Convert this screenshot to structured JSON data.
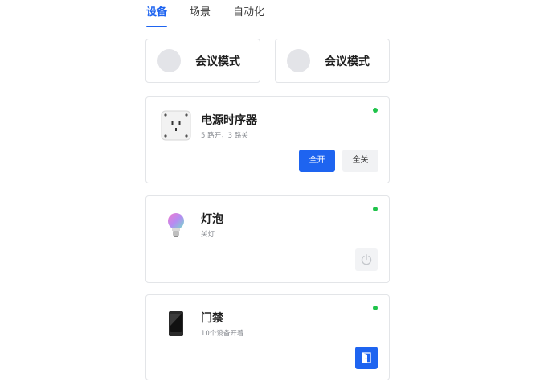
{
  "tabs": [
    {
      "label": "设备",
      "active": true
    },
    {
      "label": "场景",
      "active": false
    },
    {
      "label": "自动化",
      "active": false
    }
  ],
  "scenes": [
    {
      "label": "会议模式"
    },
    {
      "label": "会议模式"
    }
  ],
  "devices": [
    {
      "name": "电源时序器",
      "subtitle": "5 路开，3 路关",
      "icon": "power-sequencer-icon",
      "online": true,
      "buttons": {
        "on": "全开",
        "off": "全关"
      }
    },
    {
      "name": "灯泡",
      "subtitle": "关灯",
      "icon": "bulb-icon",
      "online": true,
      "action_icon": "power-icon"
    },
    {
      "name": "门禁",
      "subtitle": "10个设备开着",
      "icon": "access-control-icon",
      "online": true,
      "action_icon": "door-open-icon"
    }
  ],
  "colors": {
    "accent": "#1e64f0",
    "online": "#1fc34a",
    "border": "#e3e5e8",
    "muted_text": "#8a8d93"
  }
}
